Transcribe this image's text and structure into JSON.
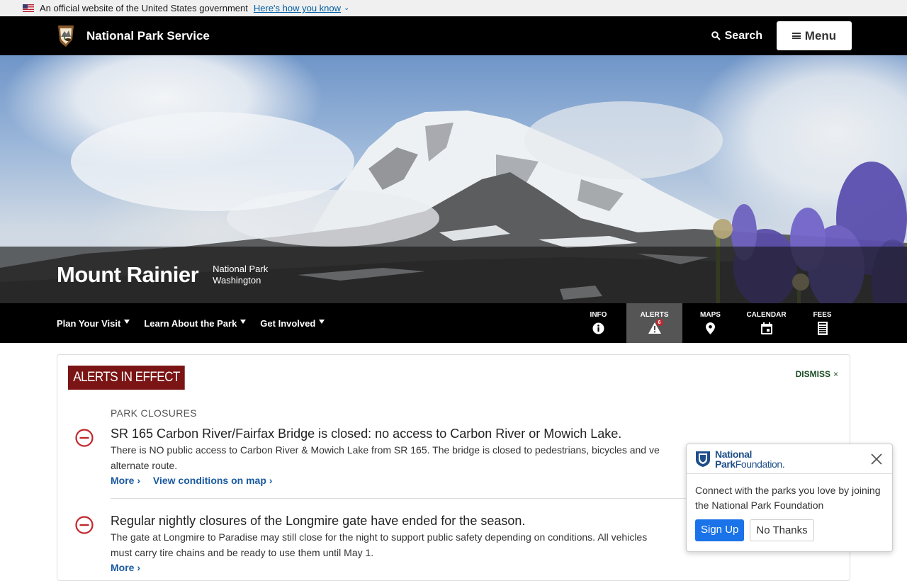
{
  "gov_banner": {
    "text": "An official website of the United States government",
    "link": "Here's how you know"
  },
  "header": {
    "brand": "National Park Service",
    "search_label": "Search",
    "menu_label": "Menu"
  },
  "hero": {
    "park_name": "Mount Rainier",
    "designation": "National Park",
    "state": "Washington"
  },
  "park_nav": {
    "items": [
      "Plan Your Visit",
      "Learn About the Park",
      "Get Involved"
    ],
    "tools": [
      {
        "label": "INFO",
        "icon": "info-icon"
      },
      {
        "label": "ALERTS",
        "icon": "alert-icon",
        "badge": "6",
        "active": true
      },
      {
        "label": "MAPS",
        "icon": "map-pin-icon"
      },
      {
        "label": "CALENDAR",
        "icon": "calendar-icon"
      },
      {
        "label": "FEES",
        "icon": "receipt-icon"
      }
    ]
  },
  "alerts": {
    "heading": "ALERTS IN EFFECT",
    "dismiss": "DISMISS",
    "category": "PARK CLOSURES",
    "items": [
      {
        "title": "SR 165 Carbon River/Fairfax Bridge is closed: no access to Carbon River or Mowich Lake.",
        "body_line1": "There is NO public access to Carbon River & Mowich Lake from SR 165. The bridge is closed to pedestrians, bicycles and ve",
        "body_line2": "alternate route.",
        "more": "More ›",
        "map_link": "View conditions on map ›"
      },
      {
        "title": "Regular nightly closures of the Longmire gate have ended for the season.",
        "body_line1": "The gate at Longmire to Paradise may still close for the night to support public safety depending on conditions. All vehicles",
        "body_line2": "must carry tire chains and be ready to use them until May 1.",
        "more": "More ›"
      }
    ]
  },
  "npf_popup": {
    "logo_line1": "National",
    "logo_line2_bold": "Park",
    "logo_line2_rest": "Foundation.",
    "message": "Connect with the parks you love by joining the National Park Foundation",
    "signup": "Sign Up",
    "no_thanks": "No Thanks"
  },
  "colors": {
    "alert_header_bg": "#7b1414",
    "alert_icon": "#c1272d",
    "link": "#1a5aa0",
    "npf_blue": "#1e4f8a",
    "signup_bg": "#1a73e8"
  }
}
